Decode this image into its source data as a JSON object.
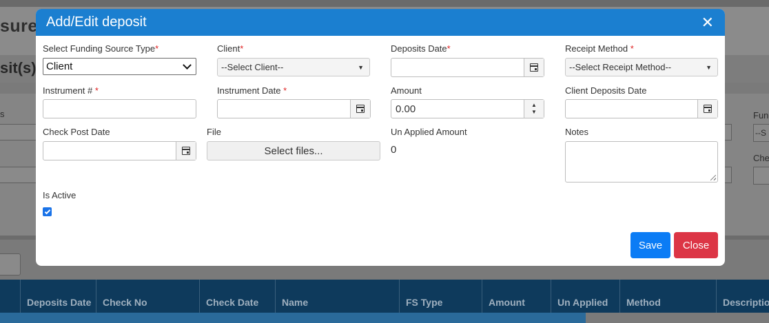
{
  "background": {
    "brand_fragment": "sureF",
    "page_title_fragment": "sit(s)",
    "left_label_fragment": "s",
    "right_label1_fragment": "Fund",
    "right_field1_fragment": "--S",
    "right_label2_fragment": "Che",
    "grid_columns": [
      "",
      "Deposits Date",
      "Check No",
      "Check Date",
      "Name",
      "FS Type",
      "Amount",
      "Un Applied",
      "Method",
      "Description"
    ]
  },
  "modal": {
    "title": "Add/Edit deposit",
    "close_icon": "close-icon",
    "fields": {
      "funding_source_type": {
        "label": "Select Funding Source Type",
        "required": "*",
        "value": "Client"
      },
      "client": {
        "label": "Client",
        "required": "*",
        "placeholder": "--Select Client--"
      },
      "deposits_date": {
        "label": "Deposits Date",
        "required": "*",
        "value": ""
      },
      "receipt_method": {
        "label": "Receipt Method",
        "required": "*",
        "placeholder": "--Select Receipt Method--"
      },
      "instrument_no": {
        "label": "Instrument #",
        "required": "*",
        "value": ""
      },
      "instrument_date": {
        "label": "Instrument Date",
        "required": "*",
        "value": ""
      },
      "amount": {
        "label": "Amount",
        "value": "0.00"
      },
      "client_deposits_date": {
        "label": "Client Deposits Date",
        "value": ""
      },
      "check_post_date": {
        "label": "Check Post Date",
        "value": ""
      },
      "file": {
        "label": "File",
        "button": "Select files..."
      },
      "un_applied_amount": {
        "label": "Un Applied Amount",
        "value": "0"
      },
      "notes": {
        "label": "Notes",
        "value": ""
      },
      "is_active": {
        "label": "Is Active",
        "checked": true
      }
    },
    "buttons": {
      "save": "Save",
      "close": "Close"
    }
  },
  "colors": {
    "header": "#1b7fd0",
    "save": "#0b7cf5",
    "close": "#dc3545",
    "required": "#e02424",
    "grid_header": "#0e3a5c"
  }
}
